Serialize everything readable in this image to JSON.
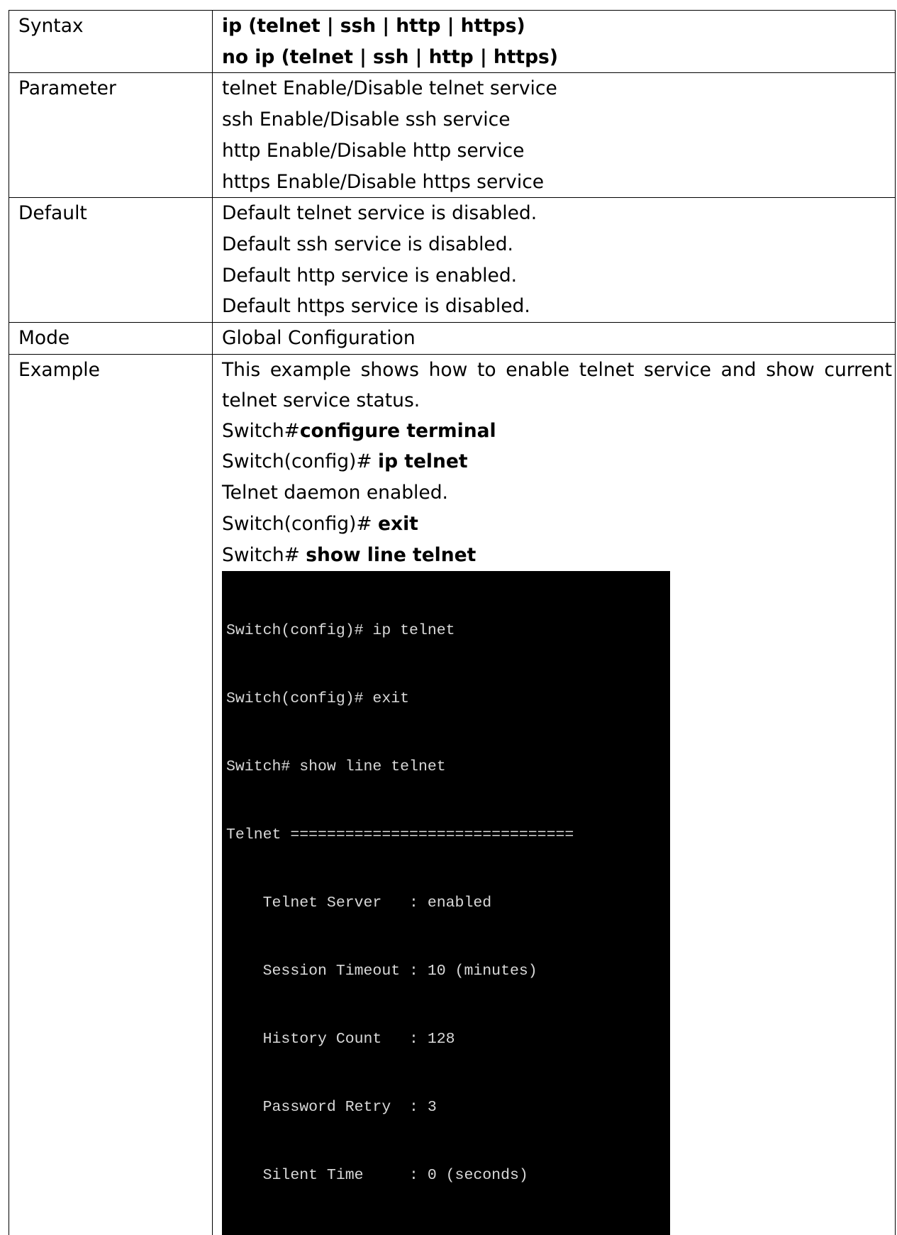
{
  "rows": {
    "syntax": {
      "label": "Syntax",
      "lines": [
        "ip (telnet | ssh | http | https)",
        "no ip (telnet | ssh | http | https)"
      ]
    },
    "parameter": {
      "label": "Parameter",
      "lines": [
        "telnet Enable/Disable telnet service",
        "ssh Enable/Disable ssh service",
        "http Enable/Disable http service",
        "https Enable/Disable https service"
      ]
    },
    "default": {
      "label": "Default",
      "lines": [
        "Default telnet service is disabled.",
        "Default ssh service is disabled.",
        "Default http service is enabled.",
        "Default https service is disabled."
      ]
    },
    "mode": {
      "label": "Mode",
      "value": "Global Configuration"
    },
    "example": {
      "label": "Example",
      "description": "This example shows how to enable telnet service and show current telnet service status.",
      "steps": [
        {
          "prompt": "Switch#",
          "command": "configure terminal"
        },
        {
          "prompt": "Switch(config)# ",
          "command": "ip telnet"
        },
        {
          "output": "Telnet daemon enabled."
        },
        {
          "prompt": "Switch(config)# ",
          "command": "exit"
        },
        {
          "prompt": "Switch# ",
          "command": "show line telnet"
        }
      ],
      "terminal_lines": [
        "Switch(config)# ip telnet",
        "Switch(config)# exit",
        "Switch# show line telnet",
        "Telnet ===============================",
        "    Telnet Server   : enabled",
        "    Session Timeout : 10 (minutes)",
        "    History Count   : 128",
        "    Password Retry  : 3",
        "    Silent Time     : 0 (seconds)"
      ]
    }
  }
}
